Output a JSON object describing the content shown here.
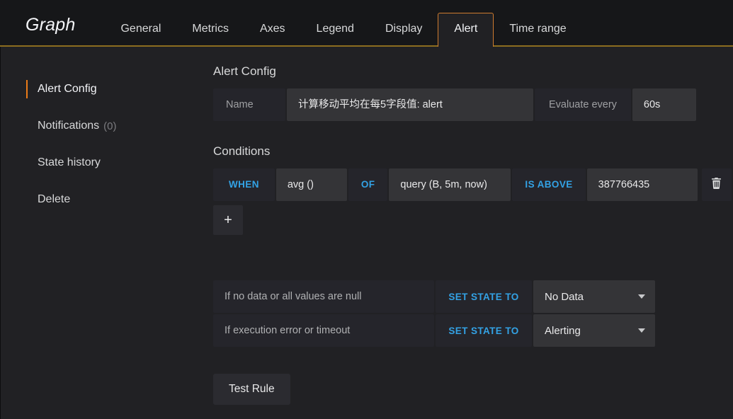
{
  "header": {
    "panel_title": "Graph",
    "tabs": [
      {
        "label": "General",
        "active": false
      },
      {
        "label": "Metrics",
        "active": false
      },
      {
        "label": "Axes",
        "active": false
      },
      {
        "label": "Legend",
        "active": false
      },
      {
        "label": "Display",
        "active": false
      },
      {
        "label": "Alert",
        "active": true
      },
      {
        "label": "Time range",
        "active": false
      }
    ],
    "accent_color": "#cf7c2f",
    "underline_color": "#8c6d1f"
  },
  "sidebar": {
    "items": [
      {
        "label": "Alert Config",
        "count": "",
        "active": true
      },
      {
        "label": "Notifications",
        "count": "(0)",
        "active": false
      },
      {
        "label": "State history",
        "count": "",
        "active": false
      },
      {
        "label": "Delete",
        "count": "",
        "active": false
      }
    ],
    "indicator_color": "#eb7b18"
  },
  "main": {
    "alert_config": {
      "title": "Alert Config",
      "name_label": "Name",
      "name_value": "计算移动平均在每5字段值: alert",
      "evaluate_label": "Evaluate every",
      "evaluate_value": "60s"
    },
    "conditions": {
      "title": "Conditions",
      "rows": [
        {
          "when": "WHEN",
          "reducer": "avg ()",
          "of": "OF",
          "query": "query (B, 5m, now)",
          "evaluator": "IS ABOVE",
          "value": "387766435",
          "delete_icon": "trash-icon"
        }
      ],
      "add_label": "+"
    },
    "state_handling": [
      {
        "description": "If no data or all values are null",
        "action": "SET STATE TO",
        "state": "No Data"
      },
      {
        "description": "If execution error or timeout",
        "action": "SET STATE TO",
        "state": "Alerting"
      }
    ],
    "test_button": "Test Rule"
  },
  "colors": {
    "keyword_blue": "#33a2e5",
    "input_bg": "#343437",
    "label_bg": "#25252b",
    "page_bg": "#212124"
  }
}
